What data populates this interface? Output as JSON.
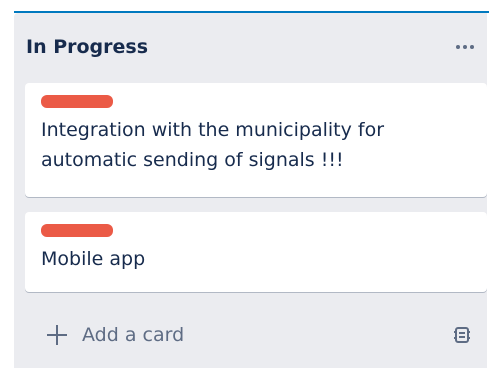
{
  "list": {
    "title": "In Progress",
    "menu_icon": "more-horizontal-icon",
    "cards": [
      {
        "title": "Integration with the municipality for automatic sending of signals !!!",
        "label_color": "#eb5a46"
      },
      {
        "title": "Mobile app",
        "label_color": "#eb5a46"
      }
    ],
    "add_card_label": "Add a card",
    "add_card_icon": "plus-icon",
    "template_icon": "card-template-icon"
  },
  "colors": {
    "list_background": "#ebecf0",
    "card_background": "#ffffff",
    "text_primary": "#172b4d",
    "text_subtle": "#5e6c84",
    "accent": "#0079bf"
  }
}
